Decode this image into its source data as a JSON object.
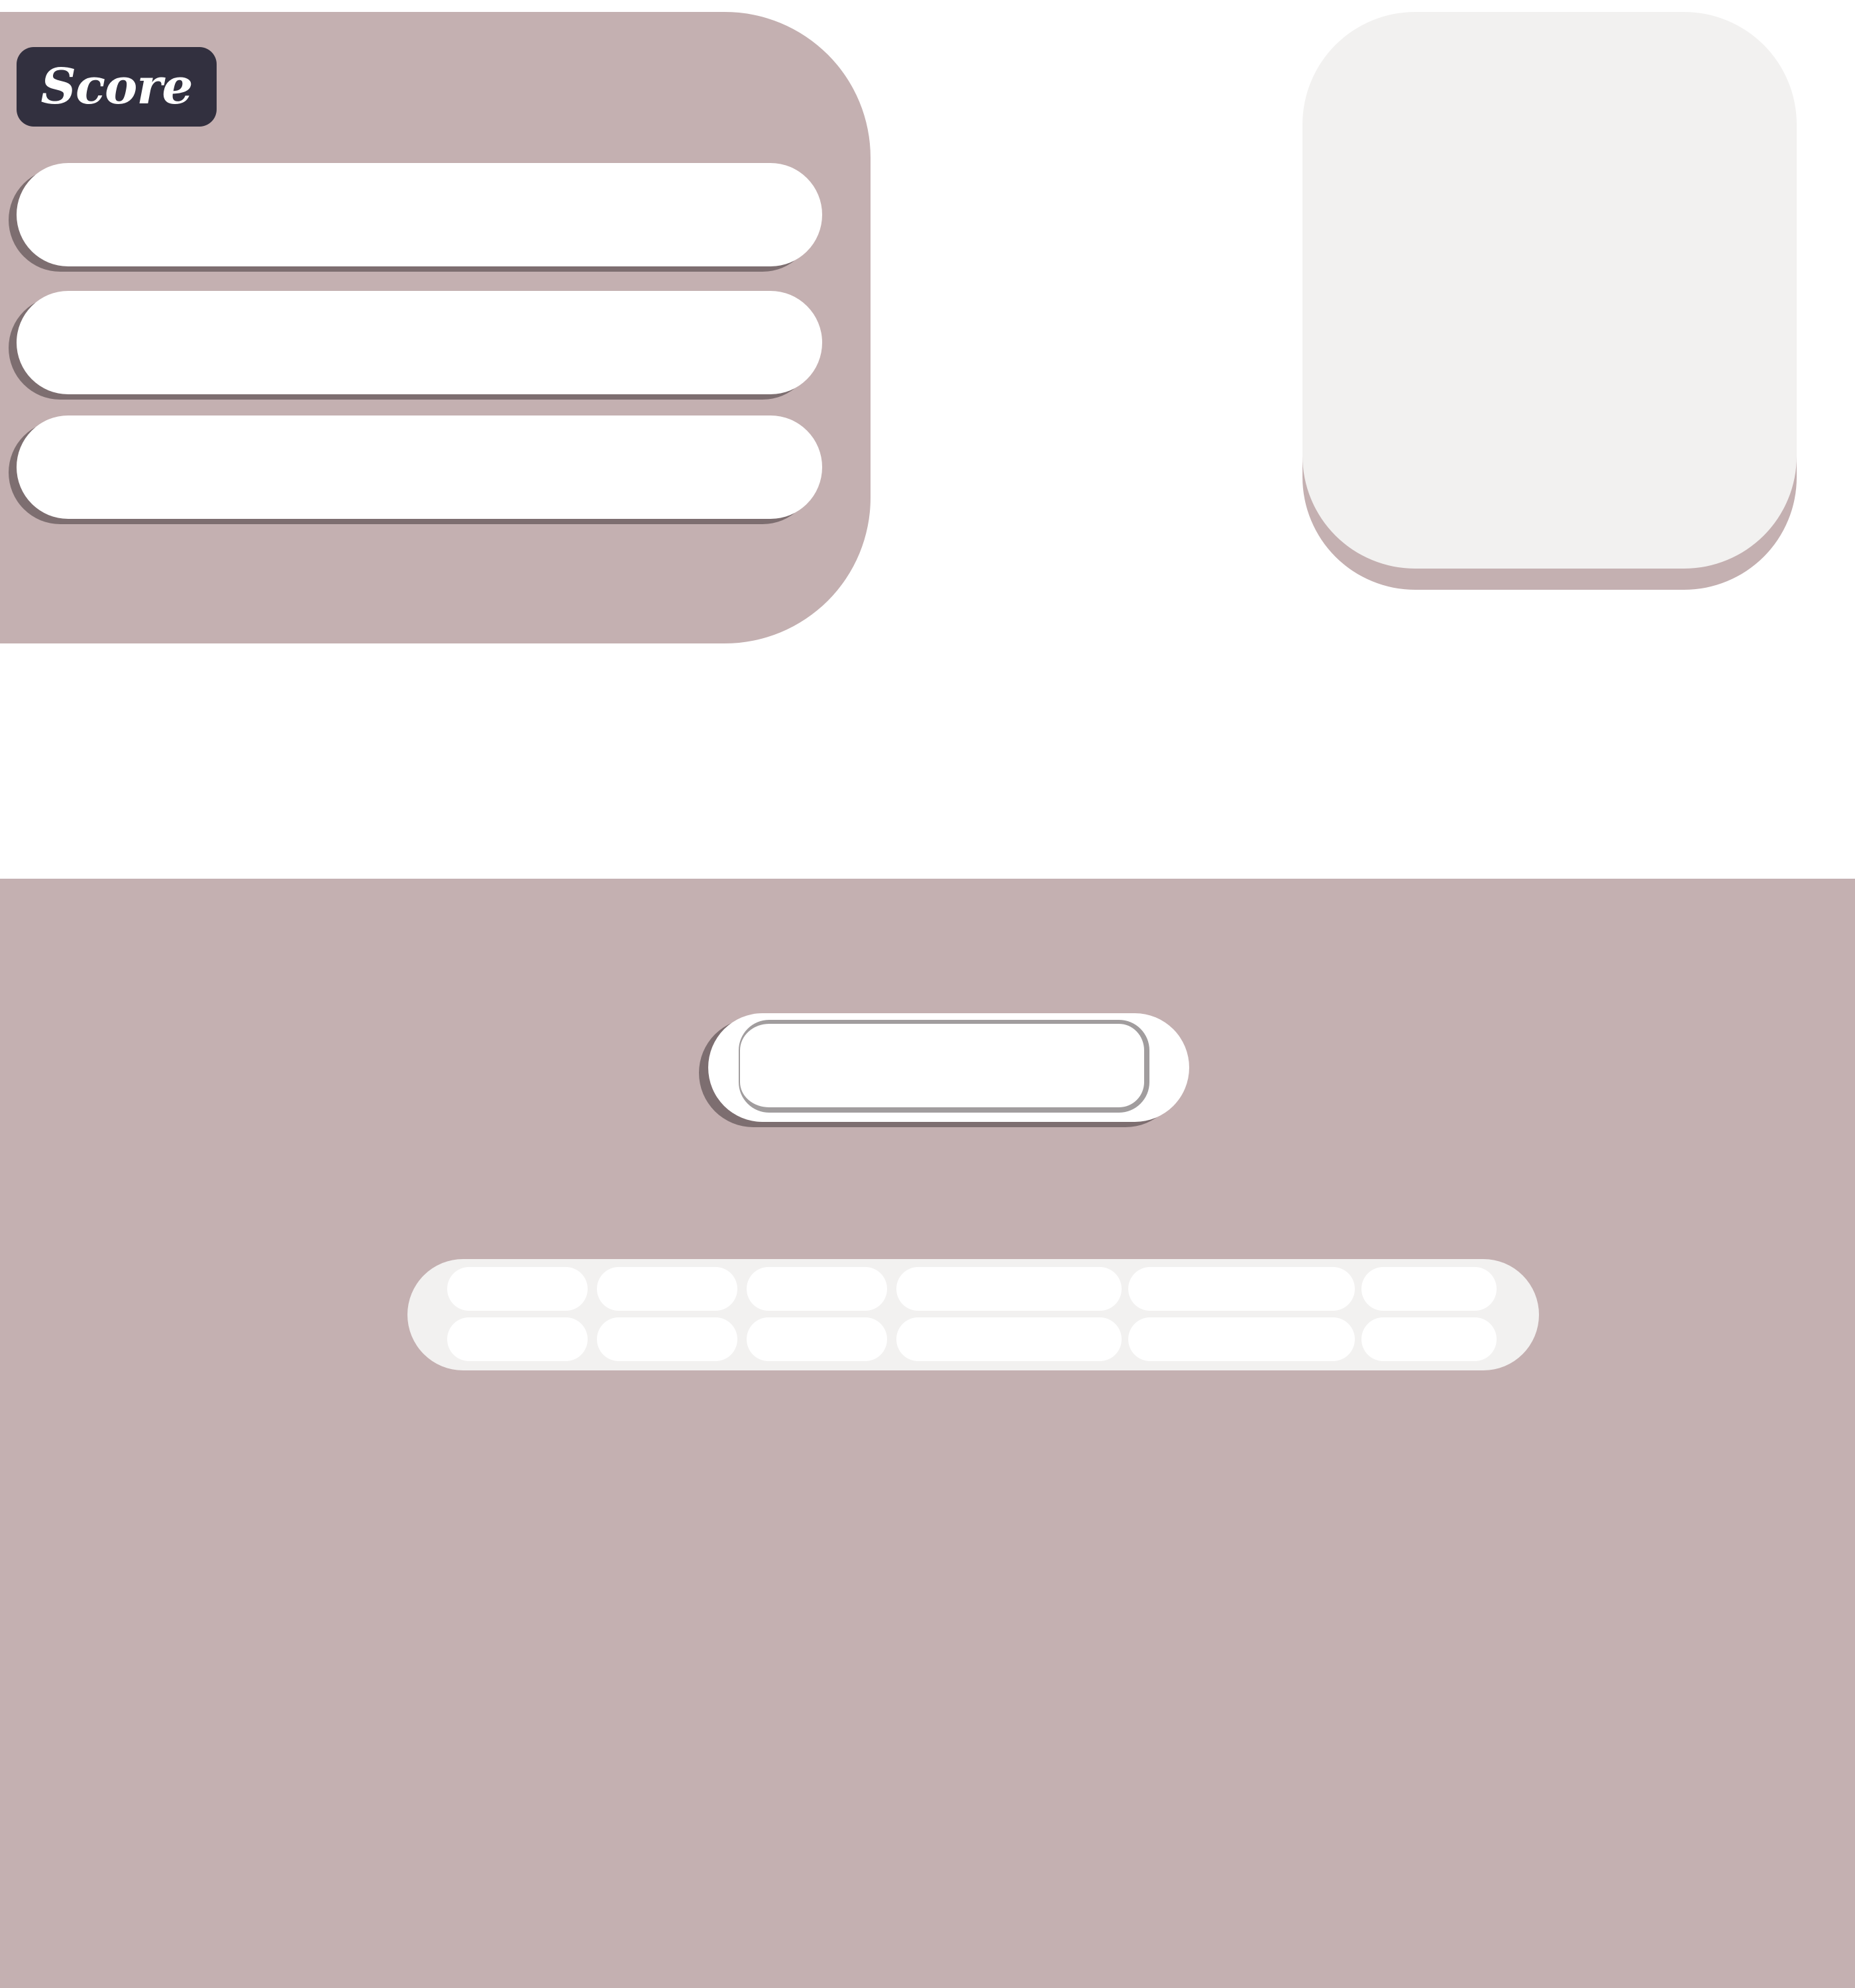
{
  "score_panel": {
    "title": "Score",
    "slots": [
      "",
      "",
      ""
    ]
  },
  "preview": {},
  "word_input": {
    "value": "",
    "placeholder": ""
  },
  "tiles": {
    "row1": [
      "",
      "",
      "",
      "",
      "",
      ""
    ],
    "row2": [
      "",
      "",
      "",
      "",
      "",
      ""
    ]
  },
  "colors": {
    "panel": "#c4b0b1",
    "title_bg": "#32303f",
    "card": "#f2f1f0",
    "slot": "#ffffff",
    "shadow": "#7d6e70"
  }
}
